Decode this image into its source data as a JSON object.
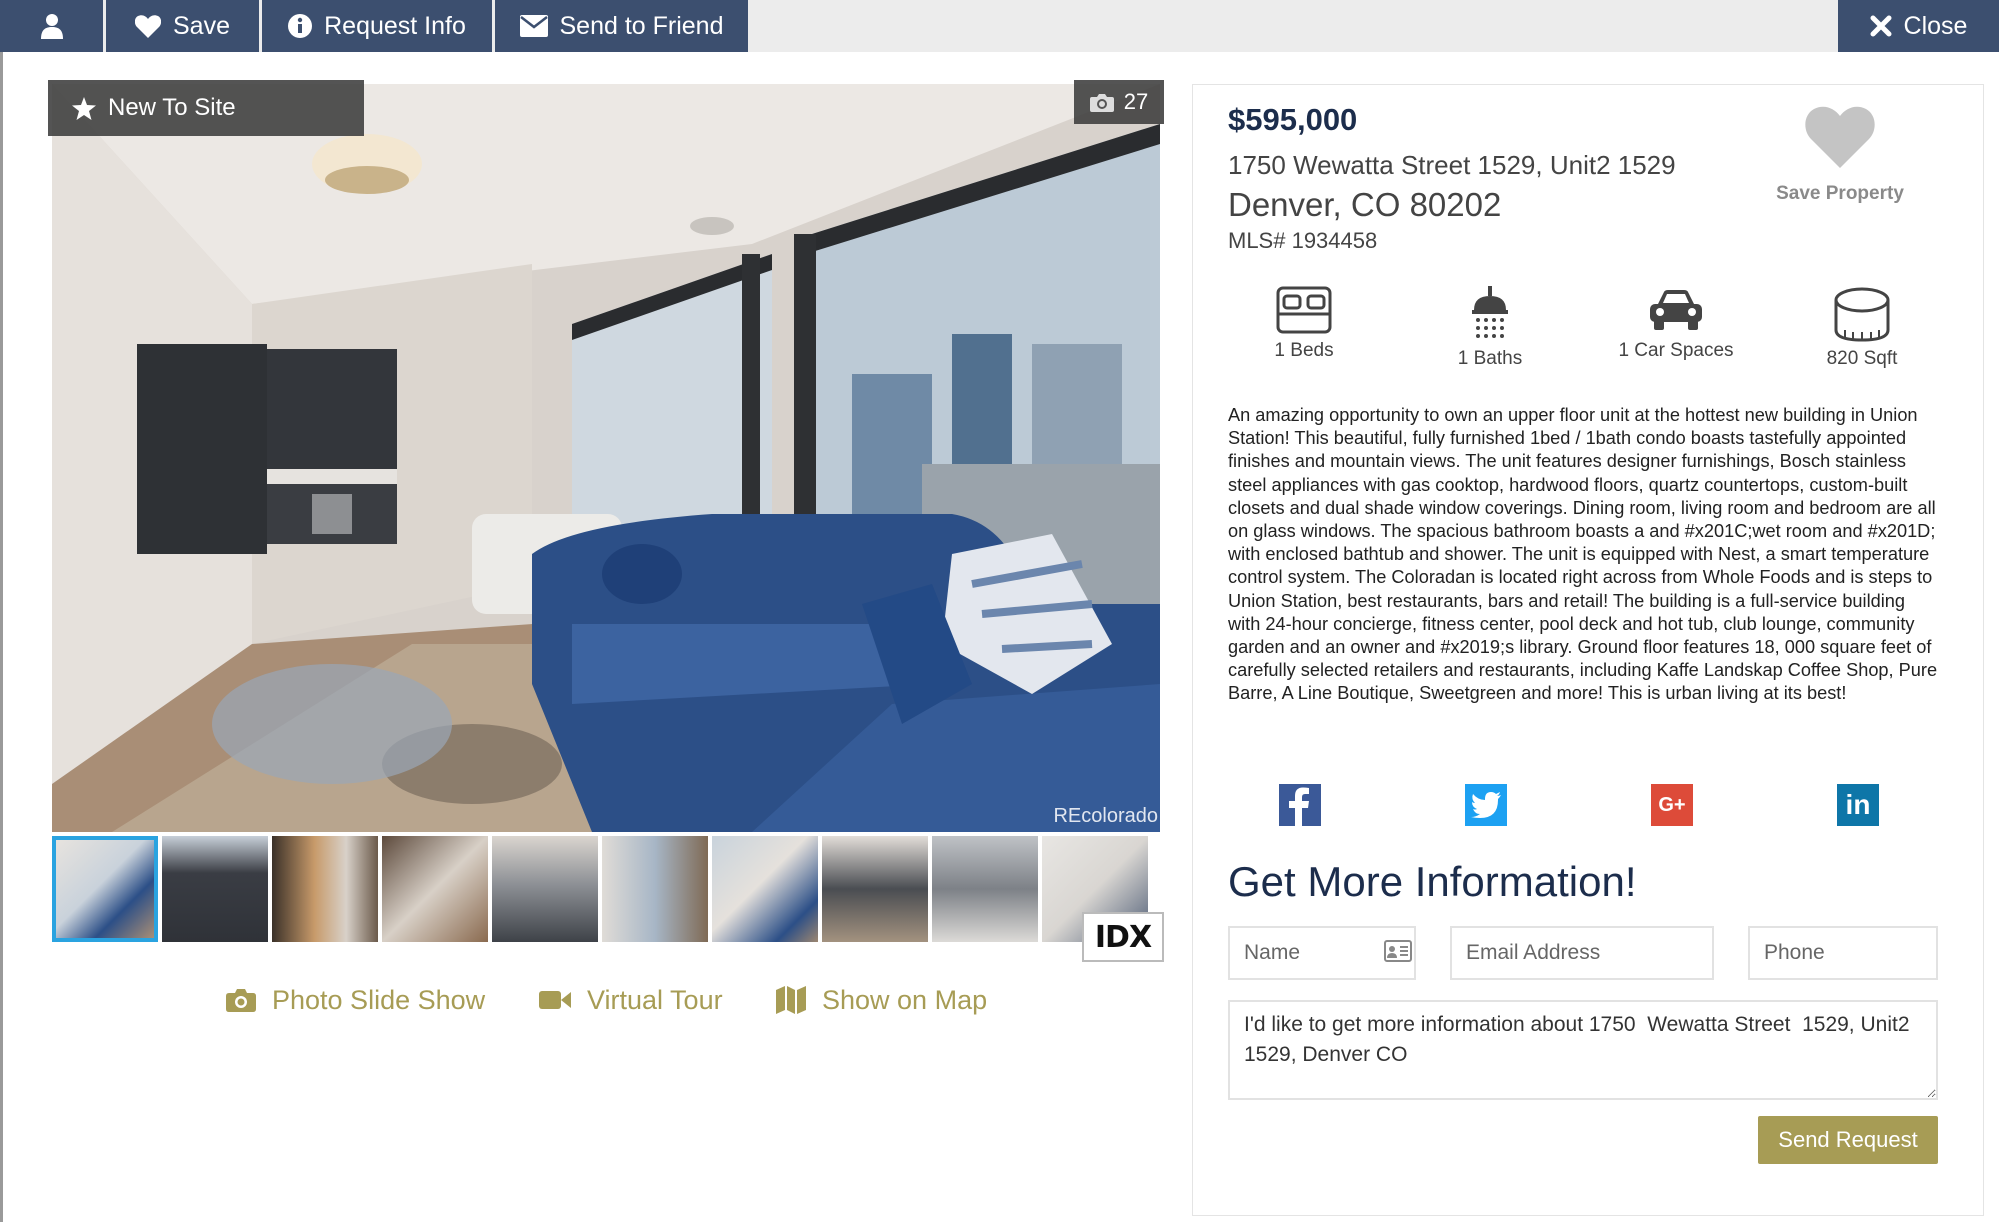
{
  "toolbar": {
    "save_label": "Save",
    "request_info_label": "Request Info",
    "send_friend_label": "Send to Friend",
    "close_label": "Close"
  },
  "gallery": {
    "badge_label": "New To Site",
    "photo_count": "27",
    "watermark": "REcolorado",
    "idx_label": "IDX",
    "thumbnails": [
      "living",
      "building",
      "lobby",
      "office",
      "kitchen",
      "dining",
      "bedroom-1",
      "kitchen-2",
      "bathroom",
      "bedroom-2"
    ]
  },
  "media_links": {
    "slideshow_label": "Photo Slide Show",
    "virtual_tour_label": "Virtual Tour",
    "map_label": "Show on Map"
  },
  "listing": {
    "price": "$595,000",
    "address_line1": "1750 Wewatta Street 1529, Unit2 1529",
    "address_line2": "Denver, CO 80202",
    "mls": "MLS# 1934458",
    "save_property_label": "Save Property",
    "features": {
      "beds": "1 Beds",
      "baths": "1 Baths",
      "cars": "1 Car Spaces",
      "sqft": "820 Sqft"
    },
    "description": "An amazing opportunity to own an upper floor unit at the hottest new building in Union Station! This beautiful, fully furnished 1bed / 1bath condo boasts tastefully appointed finishes and mountain views. The unit features designer furnishings, Bosch stainless steel appliances with gas cooktop, hardwood floors, quartz countertops, custom-built closets and dual shade window coverings. Dining room, living room and bedroom are all on glass windows. The spacious bathroom boasts a and #x201C;wet room and #x201D; with enclosed bathtub and shower. The unit is equipped with Nest, a smart temperature control system. The Coloradan is located right across from Whole Foods and is steps to Union Station, best restaurants, bars and retail! The building is a full-service building with 24-hour concierge, fitness center, pool deck and hot tub, club lounge, community garden and an owner and #x2019;s library. Ground floor features 18, 000 square feet of carefully selected retailers and restaurants, including Kaffe Landskap Coffee Shop, Pure Barre, A Line Boutique, Sweetgreen and more! This is urban living at its best!"
  },
  "social": {
    "facebook_color": "#3b5998",
    "twitter_color": "#1da1f2",
    "googleplus_color": "#dd4b39",
    "linkedin_color": "#0e76a8",
    "googleplus_label": "G+",
    "linkedin_label": "in"
  },
  "contact_form": {
    "heading": "Get More Information!",
    "name_placeholder": "Name",
    "email_placeholder": "Email Address",
    "phone_placeholder": "Phone",
    "message_value": "I'd like to get more information about 1750  Wewatta Street  1529, Unit2 1529, Denver CO",
    "send_label": "Send Request"
  },
  "colors": {
    "toolbar_bg": "#3c4f6f",
    "accent_gold": "#a79c55",
    "price_navy": "#1c2d4c",
    "thumb_active_border": "#2aa3e0"
  }
}
